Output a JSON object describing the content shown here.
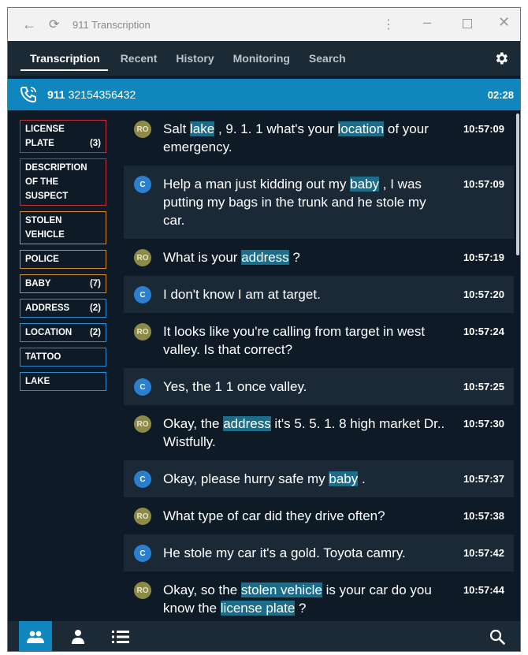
{
  "window": {
    "title": "911 Transcription"
  },
  "nav": {
    "tabs": [
      "Transcription",
      "Recent",
      "History",
      "Monitoring",
      "Search"
    ]
  },
  "call": {
    "code": "911",
    "number": "32154356432",
    "duration": "02:28"
  },
  "keywords": [
    {
      "line1": "LICENSE",
      "line2": "PLATE",
      "line3": "",
      "count": "(3)",
      "color": "red"
    },
    {
      "line1": "DESCRIPTION",
      "line2": "OF THE",
      "line3": "SUSPECT",
      "count": "",
      "color": "red"
    },
    {
      "line1": "STOLEN",
      "line2": "VEHICLE",
      "line3": "",
      "count": "",
      "color": "orange"
    },
    {
      "line1": "POLICE",
      "line2": "",
      "line3": "",
      "count": "",
      "color": "orange"
    },
    {
      "line1": "BABY",
      "line2": "",
      "line3": "",
      "count": "(7)",
      "color": "orange"
    },
    {
      "line1": "ADDRESS",
      "line2": "",
      "line3": "",
      "count": "(2)",
      "color": "blue"
    },
    {
      "line1": "LOCATION",
      "line2": "",
      "line3": "",
      "count": "(2)",
      "color": "blue"
    },
    {
      "line1": "TATTOO",
      "line2": "",
      "line3": "",
      "count": "",
      "color": "blue"
    },
    {
      "line1": "LAKE",
      "line2": "",
      "line3": "",
      "count": "",
      "color": "blue"
    }
  ],
  "messages": [
    {
      "speaker": "RO",
      "time": "10:57:09",
      "parts": [
        "Salt ",
        "lake",
        " , 9. 1. 1 what's your ",
        "location",
        " of your emergency."
      ]
    },
    {
      "speaker": "C",
      "time": "10:57:09",
      "parts": [
        "Help a man just kidding out my ",
        "baby",
        " , I was putting my bags in the trunk and he stole my car."
      ]
    },
    {
      "speaker": "RO",
      "time": "10:57:19",
      "parts": [
        "What is your ",
        "address",
        " ?"
      ]
    },
    {
      "speaker": "C",
      "time": "10:57:20",
      "parts": [
        "I don't know I am at target."
      ]
    },
    {
      "speaker": "RO",
      "time": "10:57:24",
      "parts": [
        "It looks like you're calling from target in west valley. Is that correct?"
      ]
    },
    {
      "speaker": "C",
      "time": "10:57:25",
      "parts": [
        "Yes, the 1 1 once valley."
      ]
    },
    {
      "speaker": "RO",
      "time": "10:57:30",
      "parts": [
        "Okay, the ",
        "address",
        " it's 5. 5. 1. 8 high market Dr.. Wistfully."
      ]
    },
    {
      "speaker": "C",
      "time": "10:57:37",
      "parts": [
        "Okay, please hurry safe my ",
        "baby",
        " ."
      ]
    },
    {
      "speaker": "RO",
      "time": "10:57:38",
      "parts": [
        "What type of car did they drive often?"
      ]
    },
    {
      "speaker": "C",
      "time": "10:57:42",
      "parts": [
        "He stole my car it's a gold. Toyota camry."
      ]
    },
    {
      "speaker": "RO",
      "time": "10:57:44",
      "parts": [
        "Okay, so the ",
        "stolen vehicle",
        " is your car do you know the ",
        "license plate",
        " ?"
      ]
    }
  ],
  "colors": {
    "accent": "#1086bf",
    "highlight": "#1c6d8a",
    "background": "#0e1b26"
  }
}
